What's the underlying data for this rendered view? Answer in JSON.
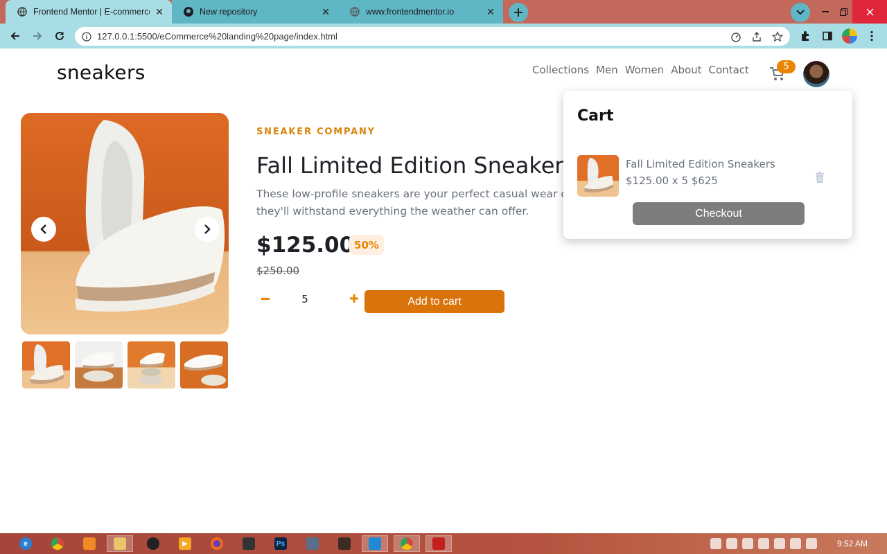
{
  "browser": {
    "tabs": [
      {
        "title": "Frontend Mentor | E-commerce p",
        "active": true
      },
      {
        "title": "New repository",
        "active": false
      },
      {
        "title": "www.frontendmentor.io",
        "active": false
      }
    ],
    "url": "127.0.0.1:5500/eCommerce%20landing%20page/index.html"
  },
  "header": {
    "logo": "sneakers",
    "nav": [
      "Collections",
      "Men",
      "Women",
      "About",
      "Contact"
    ],
    "cart_count": "5"
  },
  "product": {
    "company": "SNEAKER COMPANY",
    "title": "Fall Limited Edition Sneakers",
    "description": "These low-profile sneakers are your perfect casual wear companion. Featuring a durable rubber outer sole, they'll withstand everything the weather can offer.",
    "price": "$125.00",
    "discount": "50%",
    "old_price": "$250.00",
    "quantity": "5",
    "add_to_cart_label": "Add to cart"
  },
  "cart": {
    "title": "Cart",
    "item_name": "Fall Limited Edition Sneakers",
    "item_price_line": "$125.00 x 5 $625",
    "checkout_label": "Checkout"
  },
  "taskbar": {
    "time": "9:52 AM"
  },
  "colors": {
    "accent": "#d9730a",
    "badge": "#e98500",
    "tab_active": "#a8dde6",
    "tab_strip": "#c2695b"
  }
}
